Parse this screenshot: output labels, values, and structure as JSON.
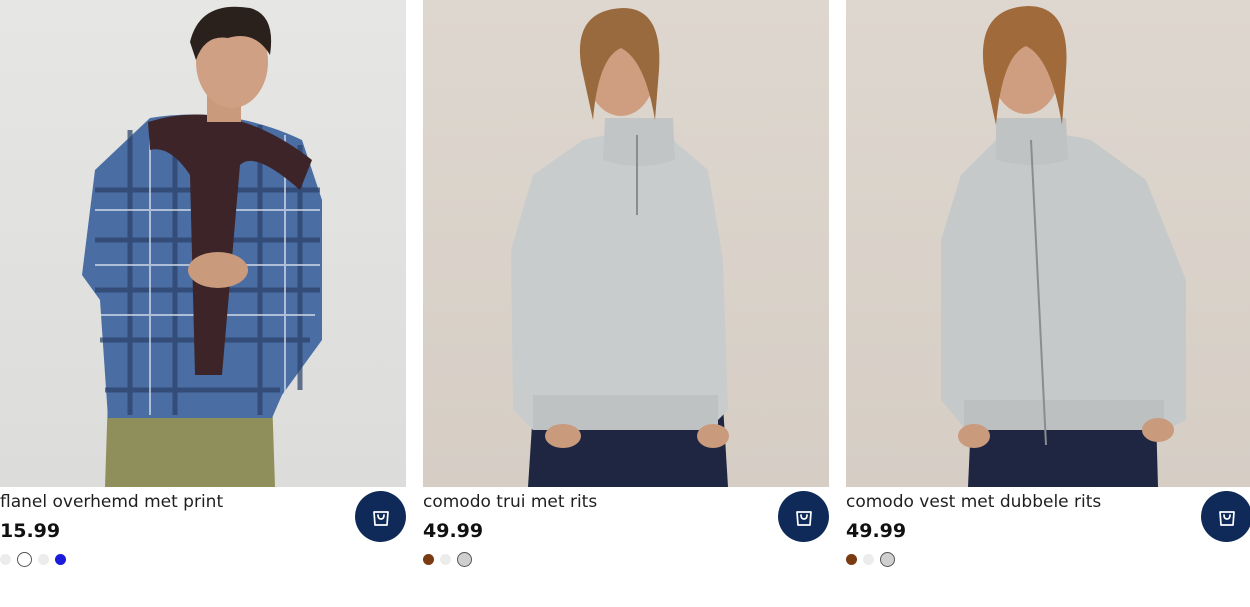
{
  "products": [
    {
      "name": "flanel overhemd met print",
      "price": "15.99",
      "swatches": [
        "#ececec",
        "#ffffff",
        "#ececec",
        "#1a1adb"
      ],
      "selected_swatch": 1
    },
    {
      "name": "comodo trui met rits",
      "price": "49.99",
      "swatches": [
        "#7a3a12",
        "#ececec",
        "#cfcfcf"
      ],
      "selected_swatch": 2
    },
    {
      "name": "comodo vest met dubbele rits",
      "price": "49.99",
      "swatches": [
        "#7a3a12",
        "#ececec",
        "#cfcfcf"
      ],
      "selected_swatch": 2
    }
  ],
  "colors": {
    "cart_button": "#0f2a59",
    "text": "#1f1f1f"
  },
  "icons": {
    "cart": "shopping-bag-icon"
  }
}
